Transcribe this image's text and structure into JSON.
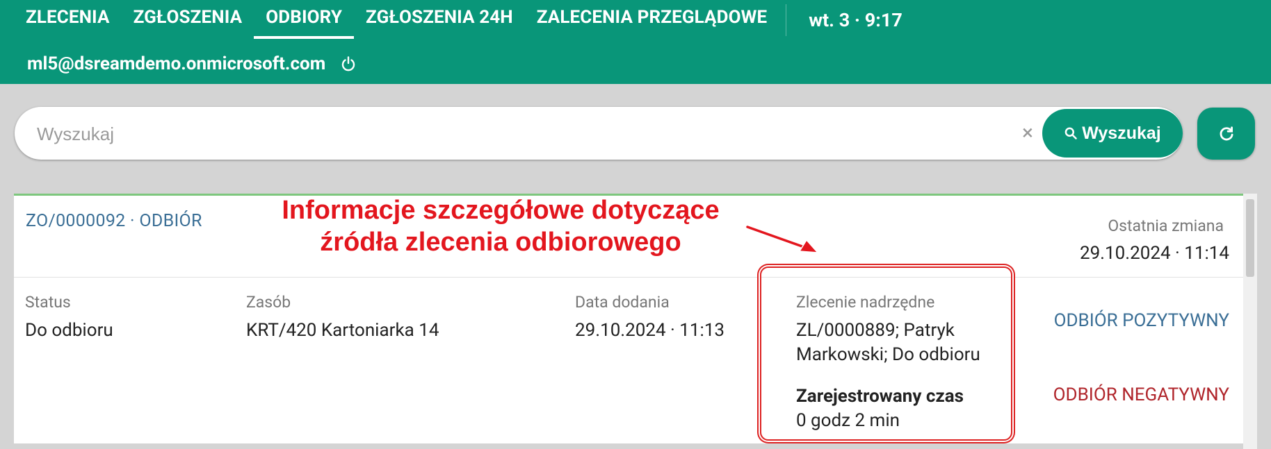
{
  "nav": {
    "tabs": [
      {
        "label": "ZLECENIA"
      },
      {
        "label": "ZGŁOSZENIA"
      },
      {
        "label": "ODBIORY"
      },
      {
        "label": "ZGŁOSZENIA 24H"
      },
      {
        "label": "ZALECENIA PRZEGLĄDOWE"
      }
    ],
    "active_tab": "ODBIORY",
    "time": "wt. 3 · 9:17",
    "user_email": "ml5@dsreamdemo.onmicrosoft.com"
  },
  "search": {
    "placeholder": "Wyszukaj",
    "value": "",
    "button_label": "Wyszukaj"
  },
  "card": {
    "id_title": "ZO/0000092 · ODBIÓR",
    "last_change_label": "Ostatnia zmiana",
    "last_change_value": "29.10.2024 · 11:14",
    "fields": {
      "status_label": "Status",
      "status_value": "Do odbioru",
      "resource_label": "Zasób",
      "resource_value": "KRT/420 Kartoniarka 14",
      "date_label": "Data dodania",
      "date_value": "29.10.2024 · 11:13",
      "parent_label": "Zlecenie nadrzędne",
      "parent_value_line1": "ZL/0000889; Patryk",
      "parent_value_line2": "Markowski; Do odbioru",
      "time_label": "Zarejestrowany czas",
      "time_value": "0 godz 2 min"
    },
    "actions": {
      "positive": "ODBIÓR POZYTYWNY",
      "negative": "ODBIÓR NEGATYWNY"
    }
  },
  "annotation": {
    "line1": "Informacje szczegółowe dotyczące",
    "line2": "źródła zlecenia odbiorowego"
  },
  "colors": {
    "primary": "#099679",
    "link_blue": "#3b6f96",
    "danger": "#b0252b",
    "annotation_red": "#e3161e"
  }
}
